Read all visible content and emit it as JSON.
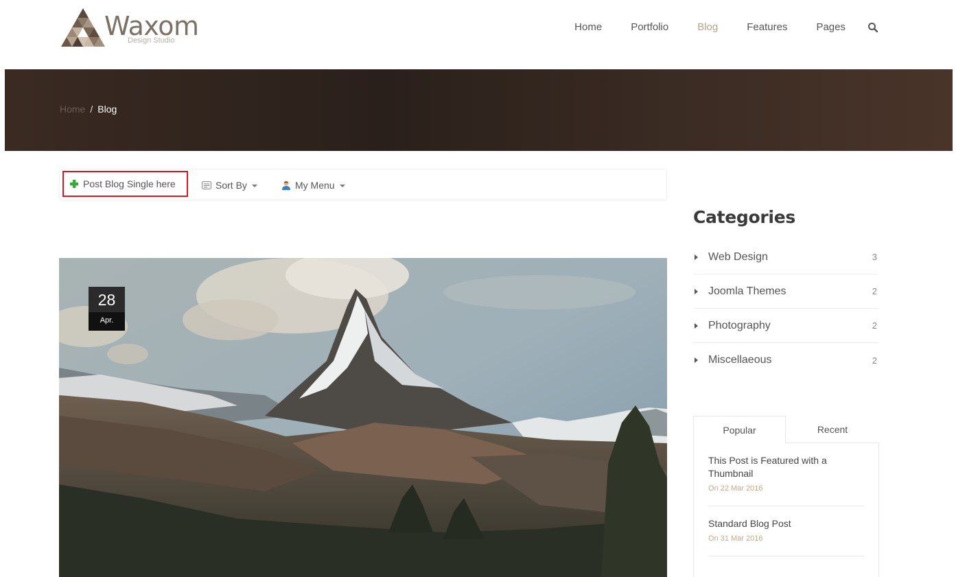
{
  "brand": {
    "name": "Waxom",
    "tagline": "Design Studio"
  },
  "nav": {
    "items": [
      {
        "label": "Home",
        "active": false
      },
      {
        "label": "Portfolio",
        "active": false
      },
      {
        "label": "Blog",
        "active": true
      },
      {
        "label": "Features",
        "active": false
      },
      {
        "label": "Pages",
        "active": false
      }
    ],
    "search_icon": "search-icon"
  },
  "breadcrumb": {
    "home": "Home",
    "separator": "/",
    "current": "Blog"
  },
  "toolbar": {
    "post_label": "Post Blog Single here",
    "sort_label": "Sort By",
    "menu_label": "My Menu"
  },
  "feature": {
    "day": "28",
    "month": "Apr."
  },
  "sidebar": {
    "categories_title": "Categories",
    "categories": [
      {
        "label": "Web Design",
        "count": "3"
      },
      {
        "label": "Joomla Themes",
        "count": "2"
      },
      {
        "label": "Photography",
        "count": "2"
      },
      {
        "label": "Miscellaeous",
        "count": "2"
      }
    ],
    "tabs": [
      {
        "label": "Popular"
      },
      {
        "label": "Recent"
      }
    ],
    "posts": [
      {
        "title": "This Post is Featured with a Thumbnail",
        "date": "On 22 Mar 2016"
      },
      {
        "title": "Standard Blog Post",
        "date": "On 31 Mar 2016"
      }
    ]
  },
  "colors": {
    "accent": "#b8a28c",
    "highlight_border": "#e0141e",
    "banner": "#3a2a22"
  }
}
